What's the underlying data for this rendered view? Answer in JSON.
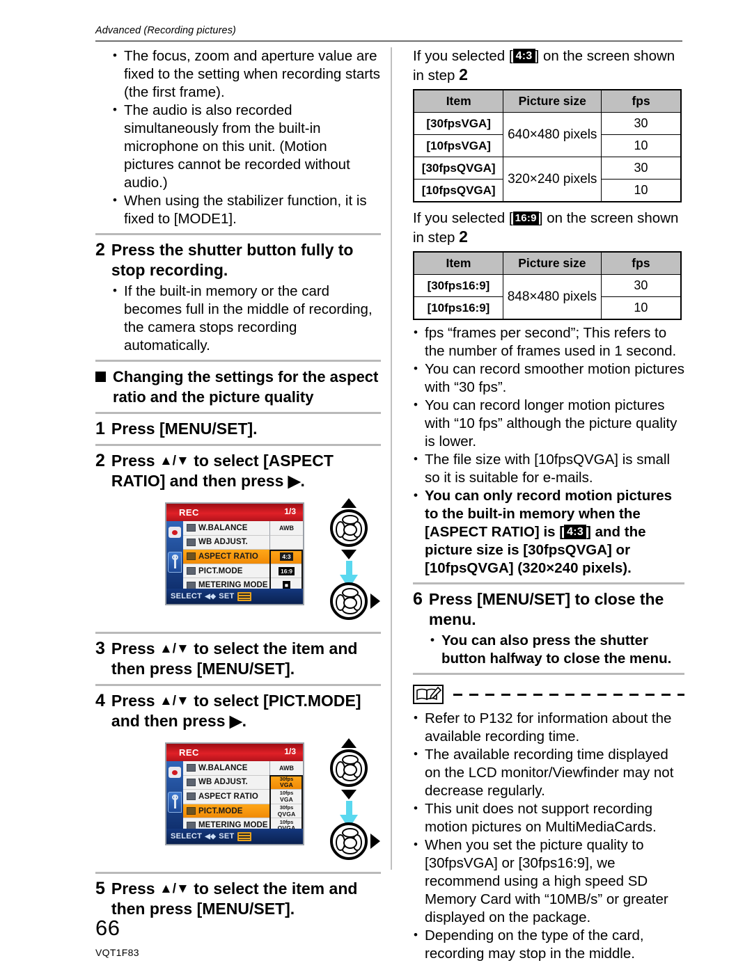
{
  "header": {
    "running_head": "Advanced (Recording pictures)"
  },
  "footer": {
    "page_number": "66",
    "model_code": "VQT1F83"
  },
  "left_column": {
    "intro_bullets": [
      "The focus, zoom and aperture value are fixed to the setting when recording starts (the first frame).",
      "The audio is also recorded simultaneously from the built-in microphone on this unit. (Motion pictures cannot be recorded without audio.)",
      "When using the stabilizer function, it is fixed to [MODE1]."
    ],
    "step2": {
      "num": "2",
      "title": "Press the shutter button fully to stop recording.",
      "bullets": [
        "If the built-in memory or the card becomes full in the middle of recording, the camera stops recording automatically."
      ]
    },
    "section_head": "Changing the settings for the aspect ratio and the picture quality",
    "step1": {
      "num": "1",
      "title": "Press [MENU/SET]."
    },
    "step2b": {
      "num": "2",
      "title_a": "Press ",
      "arrows": "▲/▼",
      "title_b": " to select [ASPECT RATIO] and then press ▶."
    },
    "step3": {
      "num": "3",
      "title_a": "Press ",
      "arrows": "▲/▼",
      "title_b": " to select the item and then press [MENU/SET]."
    },
    "step4": {
      "num": "4",
      "title_a": "Press ",
      "arrows": "▲/▼",
      "title_b": " to select [PICT.MODE] and then press ▶."
    },
    "step5": {
      "num": "5",
      "title_a": "Press ",
      "arrows": "▲/▼",
      "title_b": " to select the item and then press [MENU/SET]."
    },
    "lcd_screen_1": {
      "title": "REC",
      "page_indicator": "1/3",
      "rows": [
        {
          "label": "W.BALANCE",
          "selected": false
        },
        {
          "label": "WB ADJUST.",
          "selected": false
        },
        {
          "label": "ASPECT RATIO",
          "selected": true
        },
        {
          "label": "PICT.MODE",
          "selected": false
        },
        {
          "label": "METERING MODE",
          "selected": false
        }
      ],
      "values": [
        {
          "text": "AWB",
          "kind": "plain",
          "selected": false
        },
        {
          "text": "",
          "kind": "empty",
          "selected": false
        },
        {
          "text": "4:3",
          "kind": "chip",
          "selected": true
        },
        {
          "text": "16:9",
          "kind": "chip",
          "selected": false
        },
        {
          "text": "",
          "kind": "metering",
          "selected": false
        }
      ],
      "footer_select": "SELECT",
      "footer_set": "SET"
    },
    "lcd_screen_2": {
      "title": "REC",
      "page_indicator": "1/3",
      "rows": [
        {
          "label": "W.BALANCE",
          "selected": false
        },
        {
          "label": "WB ADJUST.",
          "selected": false
        },
        {
          "label": "ASPECT RATIO",
          "selected": false
        },
        {
          "label": "PICT.MODE",
          "selected": true
        },
        {
          "label": "METERING MODE",
          "selected": false
        }
      ],
      "values": [
        {
          "top": "",
          "bottom": "AWB",
          "kind": "plain",
          "selected": false
        },
        {
          "top": "30fps",
          "bottom": "VGA",
          "kind": "two",
          "selected": true
        },
        {
          "top": "10fps",
          "bottom": "VGA",
          "kind": "two",
          "selected": false
        },
        {
          "top": "30fps",
          "bottom": "QVGA",
          "kind": "two",
          "selected": false
        },
        {
          "top": "10fps",
          "bottom": "QVGA",
          "kind": "two",
          "selected": false
        }
      ],
      "footer_select": "SELECT",
      "footer_set": "SET"
    }
  },
  "right_column": {
    "intro_43": {
      "pre": "If you selected [",
      "badge": "4:3",
      "post": "] on the screen shown in step ",
      "step": "2"
    },
    "table_43": {
      "headers": [
        "Item",
        "Picture size",
        "fps"
      ],
      "rows": [
        {
          "item": "[30fpsVGA]",
          "size": "640×480 pixels",
          "fps": "30",
          "size_rowspan": 2
        },
        {
          "item": "[10fpsVGA]",
          "fps": "10"
        },
        {
          "item": "[30fpsQVGA]",
          "size": "320×240 pixels",
          "fps": "30",
          "size_rowspan": 2
        },
        {
          "item": "[10fpsQVGA]",
          "fps": "10"
        }
      ]
    },
    "intro_169": {
      "pre": "If you selected [",
      "badge": "16:9",
      "post": "] on the screen shown in step ",
      "step": "2"
    },
    "table_169": {
      "headers": [
        "Item",
        "Picture size",
        "fps"
      ],
      "rows": [
        {
          "item": "[30fps16:9]",
          "size": "848×480 pixels",
          "fps": "30",
          "size_rowspan": 2
        },
        {
          "item": "[10fps16:9]",
          "fps": "10"
        }
      ]
    },
    "fps_bullets": [
      "fps “frames per second”; This refers to the number of frames used in 1 second.",
      "You can record smoother motion pictures with “30 fps”.",
      "You can record longer motion pictures with “10 fps” although the picture quality is lower.",
      "The file size with [10fpsQVGA] is small so it is suitable for e-mails."
    ],
    "bold_bullet": {
      "part1": "You can only record motion pictures to the built-in memory when the [ASPECT RATIO] is [",
      "badge": "4:3",
      "part2": "] and the picture size is [30fpsQVGA] or [10fpsQVGA] (320×240 pixels)."
    },
    "step6": {
      "num": "6",
      "title": "Press [MENU/SET] to close the menu.",
      "bullets": [
        "You can also press the shutter button halfway to close the menu."
      ]
    },
    "note_bullets": [
      "Refer to P132 for information about the available recording time.",
      "The available recording time displayed on the LCD monitor/Viewfinder may not decrease regularly.",
      "This unit does not support recording motion pictures on MultiMediaCards.",
      "When you set the picture quality to [30fpsVGA] or [30fps16:9], we recommend using a high speed SD Memory Card with “10MB/s” or greater displayed on the package.",
      "Depending on the type of the card, recording may stop in the middle."
    ]
  },
  "icons": {
    "note": "book-pencil-icon",
    "cursor_pad": "cursor-pad-icon",
    "arrow_down_cyan": "down-arrow-icon"
  }
}
